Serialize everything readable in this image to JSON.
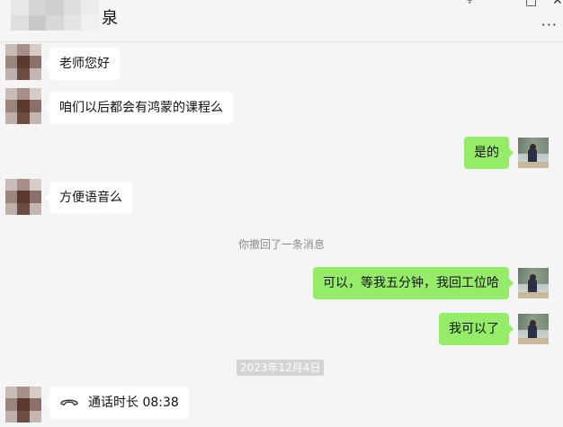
{
  "window": {
    "title": "泉",
    "controls": {
      "pin": "⍖",
      "maximize": "□",
      "close": "✕",
      "more": "···"
    }
  },
  "messages": [
    {
      "side": "left",
      "text": "老师您好"
    },
    {
      "side": "left",
      "text": "咱们以后都会有鸿蒙的课程么"
    },
    {
      "side": "right",
      "text": "是的"
    },
    {
      "side": "left",
      "text": "方便语音么"
    },
    {
      "side": "system",
      "text": "你撤回了一条消息"
    },
    {
      "side": "right",
      "text": "可以，等我五分钟，我回工位哈"
    },
    {
      "side": "right",
      "text": "我可以了"
    },
    {
      "side": "date",
      "text": "2023年12月4日"
    },
    {
      "side": "left",
      "text": "通话时长 08:38",
      "icon": "phone-icon"
    }
  ],
  "colors": {
    "background": "#f5f5f5",
    "incoming_bubble": "#ffffff",
    "outgoing_bubble": "#95ec69",
    "system_text": "#8a8a8a"
  }
}
